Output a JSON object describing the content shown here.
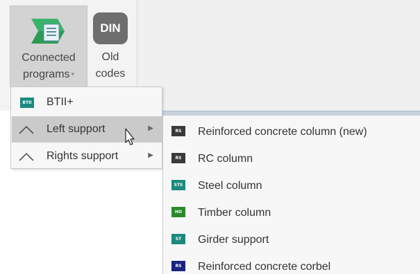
{
  "ribbon": {
    "connected_programs": {
      "line1": "Connected",
      "line2": "programs",
      "chevron": "▾",
      "icon": "connected-programs-icon"
    },
    "old_codes": {
      "icon_text": "DIN",
      "line1": "Old",
      "line2": "codes"
    }
  },
  "menu": {
    "items": [
      {
        "label": "BTII+",
        "badge": "BTII",
        "badge_color": "#1a8a7e"
      },
      {
        "label": "Left support",
        "submenu_arrow": "▶"
      },
      {
        "label": "Rights support",
        "submenu_arrow": "▶"
      }
    ]
  },
  "submenu": {
    "items": [
      {
        "label": "Reinforced concrete column (new)",
        "badge": "RS",
        "badge_color": "#3a3a3a"
      },
      {
        "label": "RC column",
        "badge": "RS",
        "badge_color": "#3a3a3a"
      },
      {
        "label": "Steel column",
        "badge": "STS",
        "badge_color": "#1a8a7e"
      },
      {
        "label": "Timber column",
        "badge": "HO",
        "badge_color": "#2a8a2a"
      },
      {
        "label": "Girder support",
        "badge": "ST",
        "badge_color": "#1a8a7e"
      },
      {
        "label": "Reinforced concrete corbel",
        "badge": "RS",
        "badge_color": "#1a237e"
      }
    ]
  }
}
